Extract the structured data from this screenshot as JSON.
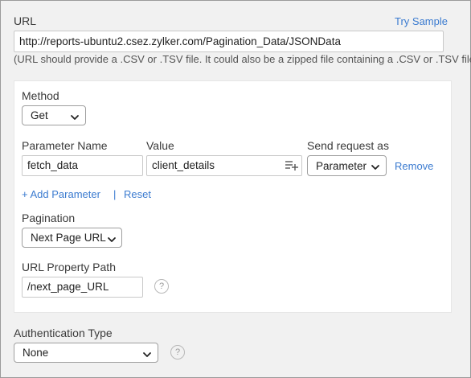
{
  "url_section": {
    "label": "URL",
    "try_sample": "Try Sample",
    "value": "http://reports-ubuntu2.csez.zylker.com/Pagination_Data/JSONData",
    "hint": "(URL should provide a .CSV or .TSV file. It could also be a zipped file containing a .CSV or .TSV file)"
  },
  "method": {
    "label": "Method",
    "selected": "Get"
  },
  "parameters": {
    "name_label": "Parameter Name",
    "value_label": "Value",
    "send_label": "Send request as",
    "rows": [
      {
        "name": "fetch_data",
        "value": "client_details",
        "send_as": "Parameter",
        "remove": "Remove"
      }
    ],
    "add": "+ Add Parameter",
    "separator": "|",
    "reset": "Reset"
  },
  "pagination": {
    "label": "Pagination",
    "selected": "Next Page URL"
  },
  "url_property_path": {
    "label": "URL Property Path",
    "value": "/next_page_URL",
    "help_icon": "question-circle-icon"
  },
  "authentication": {
    "label": "Authentication Type",
    "selected": "None",
    "help_icon": "question-circle-icon"
  },
  "colors": {
    "link": "#3b7bd0",
    "background": "#f1f1f1",
    "panel": "#ffffff"
  }
}
